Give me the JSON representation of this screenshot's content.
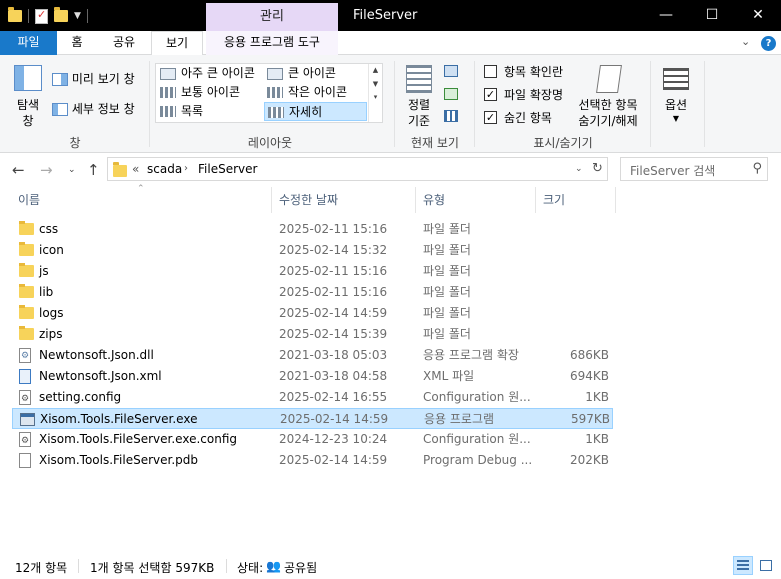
{
  "window": {
    "title": "FileServer",
    "context_tab": "관리",
    "buttons": {
      "minimize": "—",
      "maximize": "☐",
      "close": "✕"
    }
  },
  "ribbon_tabs": [
    {
      "label": "파일"
    },
    {
      "label": "홈"
    },
    {
      "label": "공유"
    },
    {
      "label": "보기"
    },
    {
      "label": "응용 프로그램 도구"
    }
  ],
  "ribbon": {
    "pane_group": {
      "nav_pane": "탐색\n창",
      "preview_pane": "미리 보기 창",
      "details_pane": "세부 정보 창",
      "label": "창"
    },
    "layout_group": {
      "items": [
        "아주 큰 아이콘",
        "큰 아이콘",
        "보통 아이콘",
        "작은 아이콘",
        "목록",
        "자세히"
      ],
      "selected": "자세히",
      "label": "레이아웃"
    },
    "current_view_group": {
      "sort_by": "정렬\n기준",
      "label": "현재 보기"
    },
    "show_hide_group": {
      "item_checkboxes": {
        "label": "항목 확인란",
        "checked": false
      },
      "file_extensions": {
        "label": "파일 확장명",
        "checked": true
      },
      "hidden_items": {
        "label": "숨긴 항목",
        "checked": true
      },
      "hide_selected": "선택한 항목\n숨기기/해제",
      "label": "표시/숨기기"
    },
    "options": {
      "label": "옵션"
    }
  },
  "address": {
    "overflow": "«",
    "crumbs": [
      "scada",
      "FileServer"
    ],
    "search_placeholder": "FileServer 검색"
  },
  "columns": {
    "name": "이름",
    "date": "수정한 날짜",
    "type": "유형",
    "size": "크기"
  },
  "files": [
    {
      "icon": "folder",
      "name": "css",
      "date": "2025-02-11 15:16",
      "type": "파일 폴더",
      "size": ""
    },
    {
      "icon": "folder",
      "name": "icon",
      "date": "2025-02-14 15:32",
      "type": "파일 폴더",
      "size": ""
    },
    {
      "icon": "folder",
      "name": "js",
      "date": "2025-02-11 15:16",
      "type": "파일 폴더",
      "size": ""
    },
    {
      "icon": "folder",
      "name": "lib",
      "date": "2025-02-11 15:16",
      "type": "파일 폴더",
      "size": ""
    },
    {
      "icon": "folder",
      "name": "logs",
      "date": "2025-02-14 14:59",
      "type": "파일 폴더",
      "size": ""
    },
    {
      "icon": "folder",
      "name": "zips",
      "date": "2025-02-14 15:39",
      "type": "파일 폴더",
      "size": ""
    },
    {
      "icon": "dll",
      "name": "Newtonsoft.Json.dll",
      "date": "2021-03-18 05:03",
      "type": "응용 프로그램 확장",
      "size": "686KB"
    },
    {
      "icon": "xml",
      "name": "Newtonsoft.Json.xml",
      "date": "2021-03-18 04:58",
      "type": "XML 파일",
      "size": "694KB"
    },
    {
      "icon": "cfg",
      "name": "setting.config",
      "date": "2025-02-14 16:55",
      "type": "Configuration 원...",
      "size": "1KB"
    },
    {
      "icon": "exe",
      "name": "Xisom.Tools.FileServer.exe",
      "date": "2025-02-14 14:59",
      "type": "응용 프로그램",
      "size": "597KB",
      "selected": true
    },
    {
      "icon": "cfg",
      "name": "Xisom.Tools.FileServer.exe.config",
      "date": "2024-12-23 10:24",
      "type": "Configuration 원...",
      "size": "1KB"
    },
    {
      "icon": "doc",
      "name": "Xisom.Tools.FileServer.pdb",
      "date": "2025-02-14 14:59",
      "type": "Program Debug ...",
      "size": "202KB"
    }
  ],
  "status": {
    "item_count": "12개 항목",
    "selection": "1개 항목 선택함 597KB",
    "state_label": "상태:",
    "state_value": "공유됨"
  }
}
